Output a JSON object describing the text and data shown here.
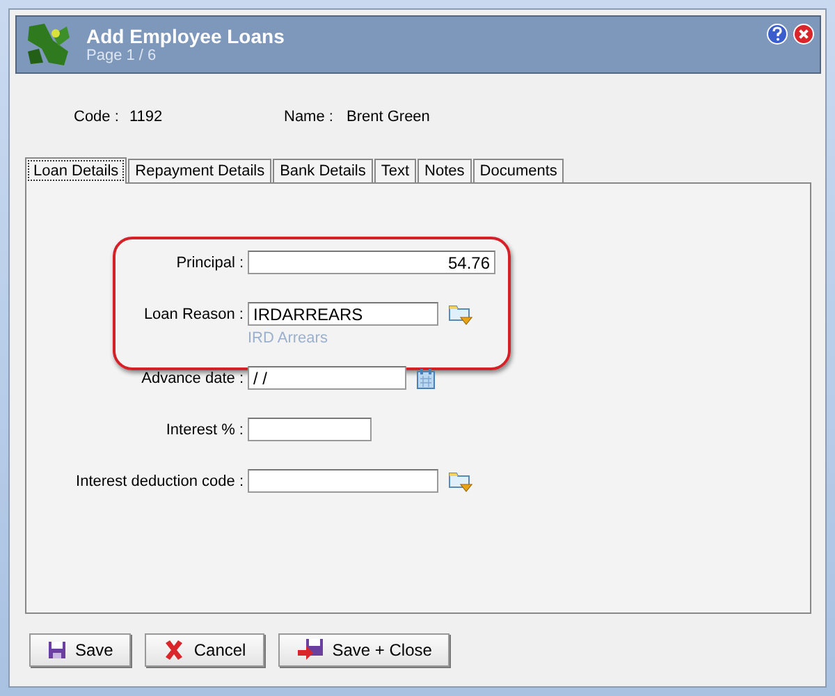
{
  "window": {
    "title": "Add Employee Loans",
    "subtitle": "Page 1 / 6"
  },
  "employee": {
    "code_label": "Code :",
    "code": "1192",
    "name_label": "Name :",
    "name": "Brent Green"
  },
  "tabs": [
    {
      "label": "Loan Details",
      "selected": true
    },
    {
      "label": "Repayment Details",
      "selected": false
    },
    {
      "label": "Bank Details",
      "selected": false
    },
    {
      "label": "Text",
      "selected": false
    },
    {
      "label": "Notes",
      "selected": false
    },
    {
      "label": "Documents",
      "selected": false
    }
  ],
  "field_groups": [
    {
      "highlighted": true,
      "fields": [
        {
          "label": "Principal :",
          "kind": "number",
          "value": "54.76"
        },
        {
          "label": "Loan Reason :",
          "kind": "lookup",
          "value": "IRDARREARS",
          "hint": "IRD Arrears"
        }
      ]
    },
    {
      "highlighted": false,
      "fields": [
        {
          "label": "Advance date :",
          "kind": "date",
          "value": " /  /"
        },
        {
          "label": "Interest % :",
          "kind": "short"
        },
        {
          "label": "Interest deduction code  :",
          "kind": "lookup"
        }
      ]
    }
  ],
  "buttons": [
    {
      "label": "Save",
      "kind": "save"
    },
    {
      "label": "Cancel",
      "kind": "cancel"
    },
    {
      "label": "Save + Close",
      "kind": "save_close"
    }
  ]
}
